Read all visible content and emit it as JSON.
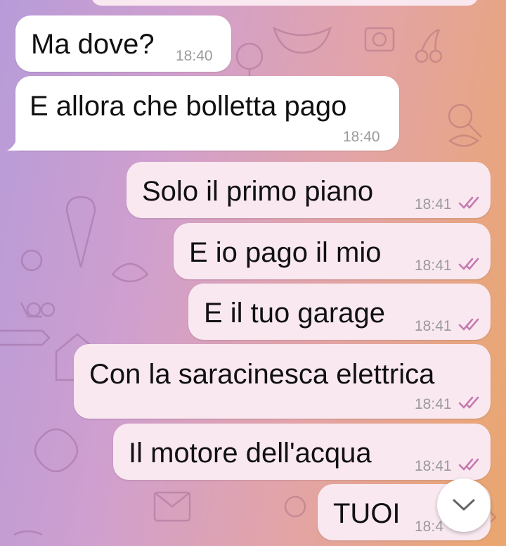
{
  "messages": [
    {
      "text": "Ma dove?",
      "time": "18:40",
      "direction": "in"
    },
    {
      "text": "E allora che bolletta pago",
      "time": "18:40",
      "direction": "in"
    },
    {
      "text": "Solo il primo piano",
      "time": "18:41",
      "direction": "out",
      "status": "read"
    },
    {
      "text": "E io pago il mio",
      "time": "18:41",
      "direction": "out",
      "status": "read"
    },
    {
      "text": "E il tuo garage",
      "time": "18:41",
      "direction": "out",
      "status": "read"
    },
    {
      "text": "Con la saracinesca elettrica",
      "time": "18:41",
      "direction": "out",
      "status": "read"
    },
    {
      "text": "Il motore dell'acqua",
      "time": "18:41",
      "direction": "out",
      "status": "read"
    },
    {
      "text": "TUOI",
      "time": "18:4",
      "direction": "out",
      "status": "read"
    }
  ],
  "scroll_button": {
    "icon": "chevron-down-icon"
  },
  "colors": {
    "incoming": "#ffffff",
    "outgoing": "#f9e8f0",
    "ticks": "#c67ab0",
    "time": "#9a9a9a"
  }
}
